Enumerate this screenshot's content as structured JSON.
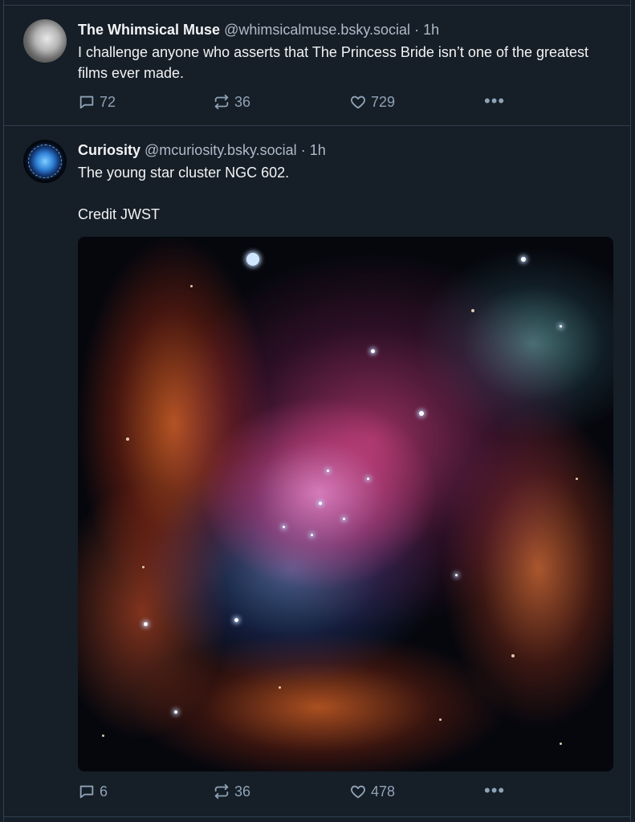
{
  "posts": [
    {
      "author_name": "The Whimsical Muse",
      "author_handle": "@whimsicalmuse.bsky.social",
      "time": "· 1h",
      "text_lines": [
        "I challenge anyone who asserts that The Princess Bride isn’t one of the greatest films ever made."
      ],
      "replies": "72",
      "reposts": "36",
      "likes": "729"
    },
    {
      "author_name": "Curiosity",
      "author_handle": "@mcuriosity.bsky.social",
      "time": "· 1h",
      "text_lines": [
        "The young star cluster NGC 602.",
        "Credit JWST"
      ],
      "replies": "6",
      "reposts": "36",
      "likes": "478"
    }
  ],
  "icons": {
    "reply": "speech-bubble-icon",
    "repost": "repost-arrows-icon",
    "like": "heart-icon",
    "more": "ellipsis-icon"
  },
  "colors": {
    "background": "#161e27",
    "border": "#2e4052",
    "text": "#f1f3f5",
    "muted": "#8fa3b7"
  }
}
